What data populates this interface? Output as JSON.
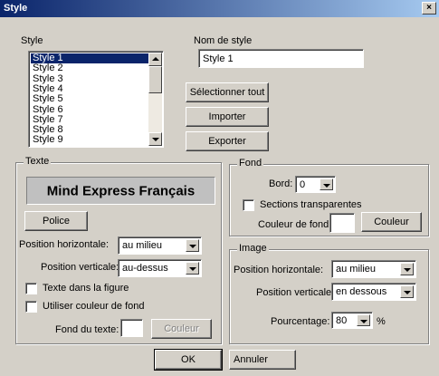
{
  "window": {
    "title": "Style",
    "close_glyph": "×"
  },
  "style_list": {
    "label": "Style",
    "items": [
      "Style 1",
      "Style 2",
      "Style 3",
      "Style 4",
      "Style 5",
      "Style 6",
      "Style 7",
      "Style 8",
      "Style 9"
    ],
    "selected": "Style 1"
  },
  "style_name": {
    "label": "Nom de style",
    "value": "Style 1"
  },
  "buttons": {
    "select_all": "Sélectionner tout",
    "import": "Importer",
    "export": "Exporter",
    "ok": "OK",
    "cancel": "Annuler"
  },
  "texte": {
    "title": "Texte",
    "preview": "Mind Express Français",
    "font_button": "Police",
    "h_pos_label": "Position horizontale:",
    "h_pos_value": "au milieu",
    "v_pos_label": "Position verticale:",
    "v_pos_value": "au-dessus",
    "in_figure_label": "Texte dans la figure",
    "use_bg_label": "Utiliser couleur de fond",
    "bg_label": "Fond du texte:",
    "color_button": "Couleur"
  },
  "fond": {
    "title": "Fond",
    "border_label": "Bord:",
    "border_value": "0",
    "transparent_label": "Sections transparentes",
    "bg_color_label": "Couleur de fond:",
    "color_button": "Couleur"
  },
  "image": {
    "title": "Image",
    "h_pos_label": "Position horizontale:",
    "h_pos_value": "au milieu",
    "v_pos_label": "Position verticale:",
    "v_pos_value": "en dessous",
    "percent_label": "Pourcentage:",
    "percent_value": "80",
    "percent_unit": "%"
  },
  "icons": {
    "close": "close-icon",
    "dropdown": "chevron-down-icon",
    "scroll_up": "arrow-up-icon",
    "scroll_down": "arrow-down-icon"
  }
}
